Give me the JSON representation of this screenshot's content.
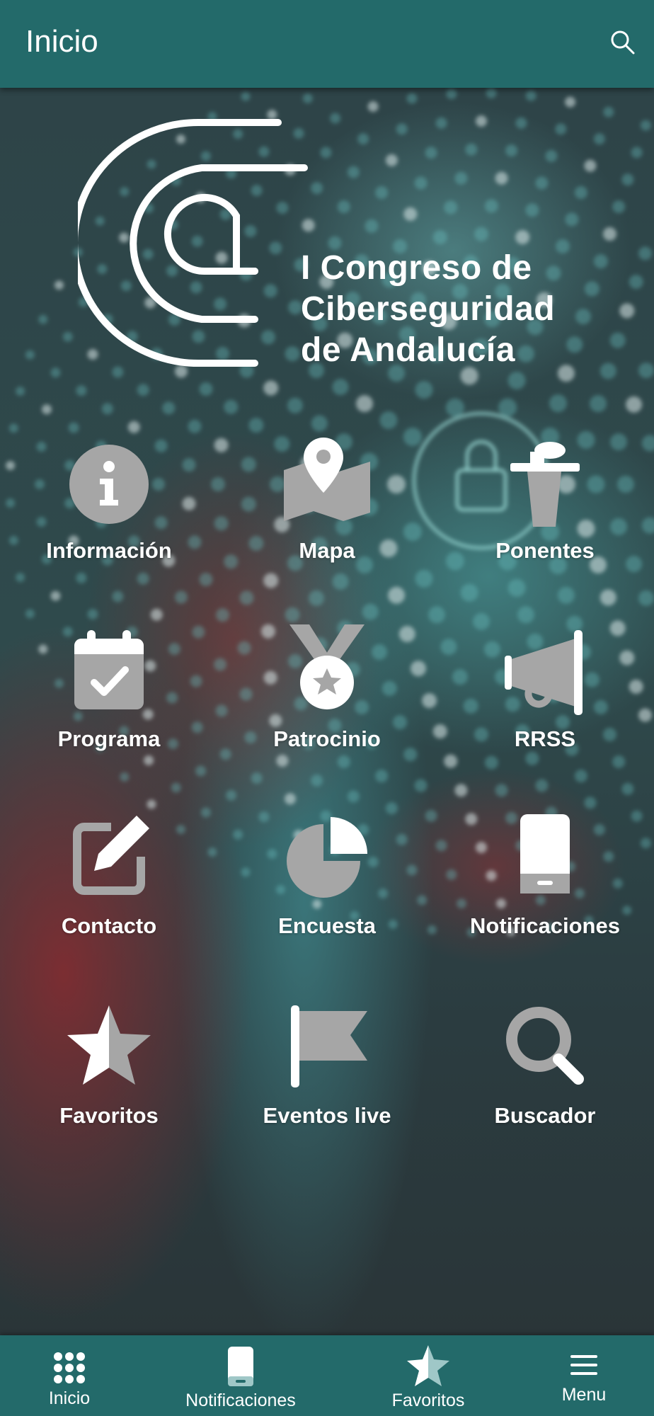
{
  "header": {
    "title": "Inicio"
  },
  "logo": {
    "line1": "I Congreso de",
    "line2": "Ciberseguridad",
    "line3": "de Andalucía"
  },
  "menu": [
    {
      "label": "Información",
      "icon": "info-icon"
    },
    {
      "label": "Mapa",
      "icon": "map-icon"
    },
    {
      "label": "Ponentes",
      "icon": "podium-icon"
    },
    {
      "label": "Programa",
      "icon": "calendar-icon"
    },
    {
      "label": "Patrocinio",
      "icon": "medal-icon"
    },
    {
      "label": "RRSS",
      "icon": "megaphone-icon"
    },
    {
      "label": "Contacto",
      "icon": "edit-icon"
    },
    {
      "label": "Encuesta",
      "icon": "pie-chart-icon"
    },
    {
      "label": "Notificaciones",
      "icon": "phone-icon"
    },
    {
      "label": "Favoritos",
      "icon": "star-icon"
    },
    {
      "label": "Eventos live",
      "icon": "flag-icon"
    },
    {
      "label": "Buscador",
      "icon": "search-icon"
    }
  ],
  "bottom_nav": [
    {
      "label": "Inicio",
      "icon": "grid-icon"
    },
    {
      "label": "Notificaciones",
      "icon": "phone-icon"
    },
    {
      "label": "Favoritos",
      "icon": "star-icon"
    },
    {
      "label": "Menu",
      "icon": "hamburger-icon"
    }
  ],
  "colors": {
    "primary": "#236a6a",
    "icon_fill": "#a6a6a6",
    "text": "#ffffff"
  }
}
